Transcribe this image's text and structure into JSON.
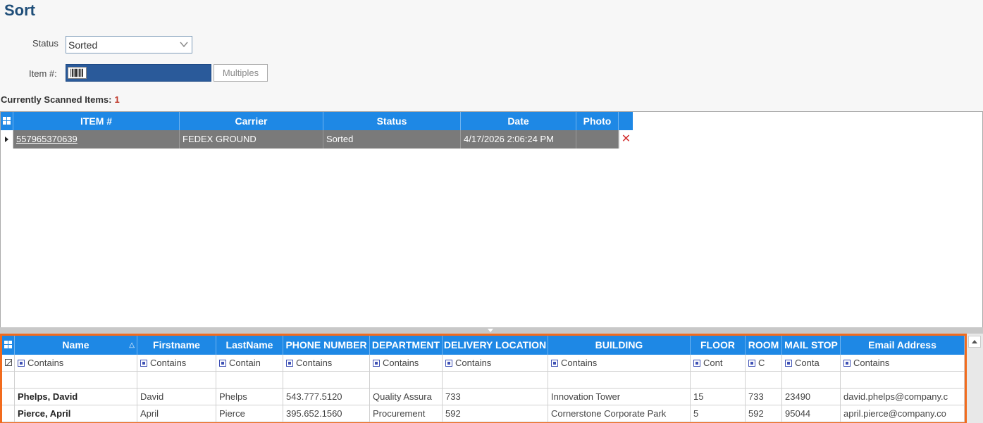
{
  "page": {
    "title": "Sort"
  },
  "form": {
    "status_label": "Status",
    "status_value": "Sorted",
    "item_label": "Item #:",
    "multiples_label": "Multiples"
  },
  "scanned": {
    "label": "Currently Scanned Items:",
    "count": "1"
  },
  "scan_grid": {
    "columns": [
      "ITEM #",
      "Carrier",
      "Status",
      "Date",
      "Photo"
    ],
    "rows": [
      {
        "item": "557965370639",
        "carrier": "FEDEX GROUND",
        "status": "Sorted",
        "date": "4/17/2026 2:06:24 PM",
        "photo": ""
      }
    ],
    "delete_glyph": "✕"
  },
  "recipient_grid": {
    "columns": [
      "Name",
      "Firstname",
      "LastName",
      "PHONE NUMBER",
      "DEPARTMENT",
      "DELIVERY LOCATION",
      "BUILDING",
      "FLOOR",
      "ROOM",
      "MAIL STOP",
      "Email Address"
    ],
    "filters": [
      "Contains",
      "Contains",
      "Contain",
      "Contains",
      "Contains",
      "Contains",
      "Contains",
      "Cont",
      "C",
      "Conta",
      "Contains"
    ],
    "rows": [
      [
        "Phelps, David",
        "David",
        "Phelps",
        "543.777.5120",
        "Quality Assura",
        "733",
        "Innovation Tower",
        "15",
        "733",
        "23490",
        "david.phelps@company.c"
      ],
      [
        "Pierce, April",
        "April",
        "Pierce",
        "395.652.1560",
        "Procurement",
        "592",
        "Cornerstone Corporate Park",
        "5",
        "592",
        "95044",
        "april.pierce@company.co"
      ]
    ]
  },
  "colors": {
    "header_blue": "#1e88e5",
    "highlight_orange": "#f26b1d",
    "title_blue": "#1f4e79",
    "selected_row_gray": "#7a7a7a"
  }
}
